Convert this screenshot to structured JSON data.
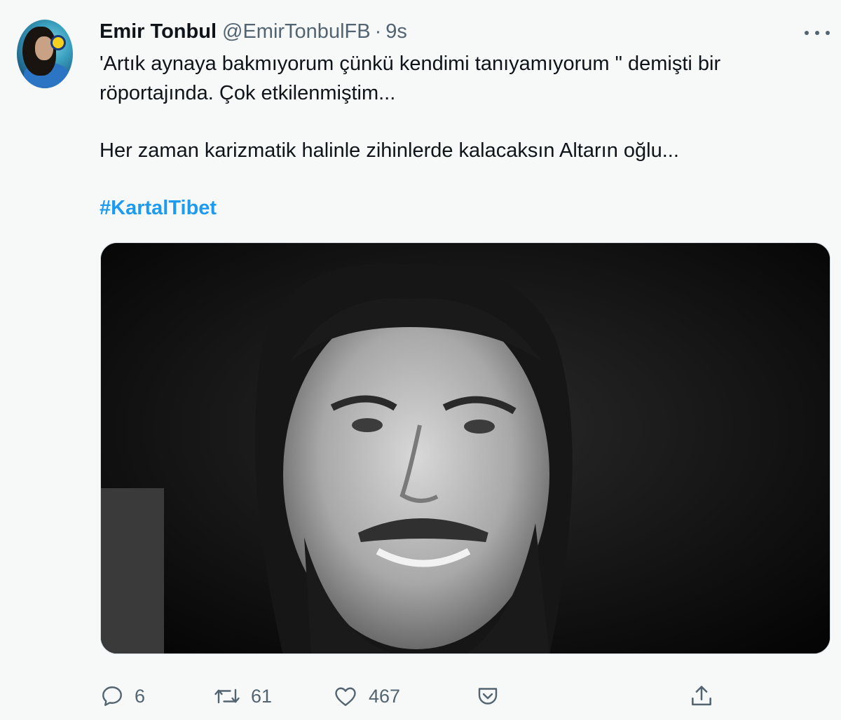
{
  "tweet": {
    "author_name": "Emir Tonbul",
    "author_handle": "@EmirTonbulFB",
    "separator": "·",
    "timestamp": "9s",
    "text_line1": "'Artık aynaya bakmıyorum çünkü kendimi tanıyamıyorum \" demişti bir röportajında. Çok etkilenmiştim...",
    "text_line2": "Her zaman karizmatik halinle zihinlerde kalacaksın Altarın oğlu...",
    "hashtag": "#KartalTibet"
  },
  "actions": {
    "reply_count": "6",
    "retweet_count": "61",
    "like_count": "467"
  },
  "icons": {
    "more": "more-horizontal-icon",
    "reply": "reply-icon",
    "retweet": "retweet-icon",
    "like": "heart-icon",
    "save": "pocket-icon",
    "share": "share-icon"
  },
  "colors": {
    "accent": "#1d9bf0",
    "muted": "#536471",
    "text": "#0f1419",
    "background": "#f7f9f9"
  }
}
